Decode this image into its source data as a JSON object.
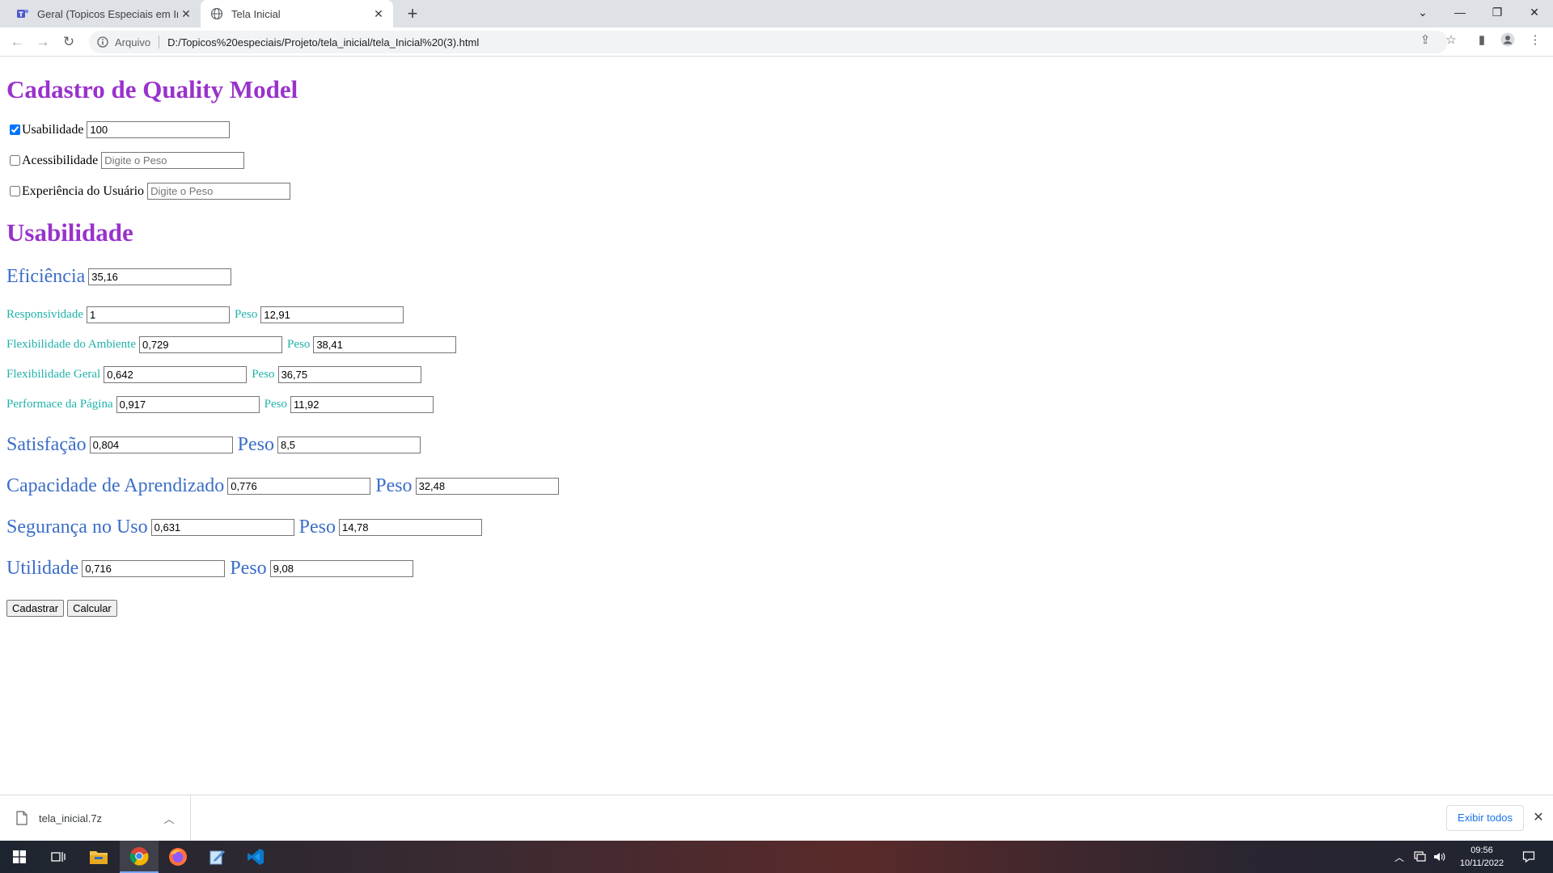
{
  "browser": {
    "tabs": [
      {
        "title": "Geral (Topicos Especiais em Infor",
        "icon": "teams-icon",
        "active": false
      },
      {
        "title": "Tela Inicial",
        "icon": "globe-icon",
        "active": true
      }
    ],
    "new_tab": "+",
    "address": {
      "scheme_label": "Arquivo",
      "url": "D:/Topicos%20especiais/Projeto/tela_inicial/tela_Inicial%20(3).html"
    }
  },
  "page": {
    "title": "Cadastro de Quality Model",
    "models": [
      {
        "label": "Usabilidade",
        "checked": true,
        "value": "100",
        "placeholder": "Digite o Peso"
      },
      {
        "label": "Acessibilidade",
        "checked": false,
        "value": "",
        "placeholder": "Digite o Peso"
      },
      {
        "label": "Experiência do Usuário",
        "checked": false,
        "value": "",
        "placeholder": "Digite o Peso"
      }
    ],
    "section_title": "Usabilidade",
    "eficiencia": {
      "label": "Eficiência",
      "value": "35,16"
    },
    "sub_items": [
      {
        "label": "Responsividade",
        "value": "1",
        "peso_label": "Peso",
        "peso": "12,91"
      },
      {
        "label": "Flexibilidade do Ambiente",
        "value": "0,729",
        "peso_label": "Peso",
        "peso": "38,41"
      },
      {
        "label": "Flexibilidade Geral",
        "value": "0,642",
        "peso_label": "Peso",
        "peso": "36,75"
      },
      {
        "label": "Performace da Página",
        "value": "0,917",
        "peso_label": "Peso",
        "peso": "11,92"
      }
    ],
    "main_items": [
      {
        "label": "Satisfação",
        "value": "0,804",
        "peso_label": "Peso",
        "peso": "8,5"
      },
      {
        "label": "Capacidade de Aprendizado",
        "value": "0,776",
        "peso_label": "Peso",
        "peso": "32,48"
      },
      {
        "label": "Segurança no Uso",
        "value": "0,631",
        "peso_label": "Peso",
        "peso": "14,78"
      },
      {
        "label": "Utilidade",
        "value": "0,716",
        "peso_label": "Peso",
        "peso": "9,08"
      }
    ],
    "buttons": {
      "cadastrar": "Cadastrar",
      "calcular": "Calcular"
    }
  },
  "downloads": {
    "file_name": "tela_inicial.7z",
    "show_all": "Exibir todos"
  },
  "taskbar": {
    "time": "09:56",
    "date": "10/11/2022"
  },
  "colors": {
    "heading": "#9932cc",
    "sub_label": "#20b2aa",
    "main_label": "#3c6ec8",
    "accent": "#1a73e8"
  }
}
